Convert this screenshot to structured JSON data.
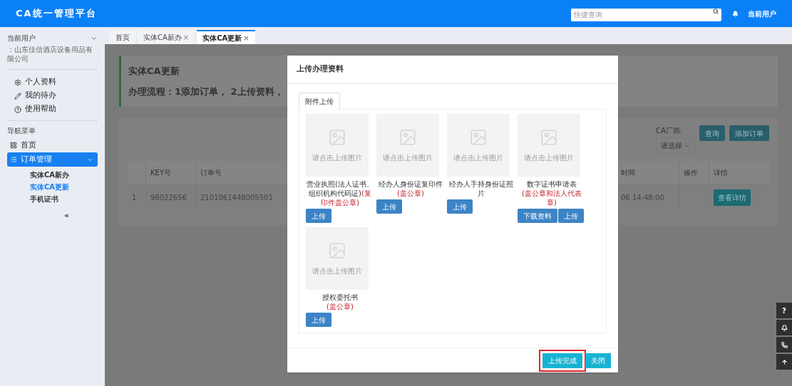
{
  "app_title": "CA统一管理平台",
  "topbar": {
    "search_placeholder": "快捷查询",
    "user": "当前用户"
  },
  "sidebar": {
    "user_label": "当前用户",
    "company": "：山东佳信酒店设备用品有限公司",
    "links": [
      {
        "label": "个人资料",
        "kind": "gear"
      },
      {
        "label": "我的待办",
        "kind": "pencil"
      },
      {
        "label": "使用帮助",
        "kind": "help"
      }
    ],
    "nav_title": "导航菜单",
    "nav": [
      {
        "label": "首页",
        "kind": "grid",
        "selected": false,
        "expanded": false
      },
      {
        "label": "订单管理",
        "kind": "list",
        "selected": true,
        "expanded": true,
        "children": [
          {
            "label": "实体CA新办",
            "selected": false
          },
          {
            "label": "实体CA更新",
            "selected": true
          },
          {
            "label": "手机证书",
            "selected": false
          }
        ]
      }
    ],
    "collapse": "«"
  },
  "tabs": [
    {
      "label": "首页",
      "selected": false
    },
    {
      "label": "实体CA新办",
      "close": "×",
      "selected": false
    },
    {
      "label": "实体CA更新",
      "close": "×",
      "selected": true
    }
  ],
  "page": {
    "title": "实体CA更新",
    "process": "办理流程：1添加订单， 2上传资料，",
    "filter_label": "CA厂商:",
    "select": "请选择",
    "buttons": [
      "查询",
      "添加订单"
    ],
    "table": {
      "columns": [
        "KEY号",
        "订单号",
        "时间",
        "操作",
        "详情"
      ],
      "rows": [
        {
          "index": "1",
          "cells": [
            "98022656",
            "2101061448005501",
            "06 14:48:00"
          ],
          "action": "查看详情"
        }
      ]
    }
  },
  "modal": {
    "title": "上传办理资料",
    "tabs": [
      {
        "label": "附件上传",
        "selected": true
      }
    ],
    "items": [
      {
        "hint": "请点击上传图片",
        "label": "营业执照(法人证书、组织机构代码证)",
        "note": "(复印件盖公章)",
        "note_inline": true,
        "buttons": [
          "上传"
        ]
      },
      {
        "hint": "请点击上传图片",
        "label": "经办人身份证复印件",
        "note": "(盖公章)",
        "note_inline": false,
        "buttons": [
          "上传"
        ]
      },
      {
        "hint": "请点击上传图片",
        "label": "经办人手持身份证照片",
        "buttons": [
          "上传"
        ]
      },
      {
        "hint": "请点击上传图片",
        "label": "数字证书申请表",
        "note": "(盖公章和法人代表章)",
        "note_inline": false,
        "buttons": [
          "下载资料",
          "上传"
        ]
      },
      {
        "hint": "请点击上传图片",
        "label": "授权委托书",
        "note": "(盖公章)",
        "note_inline": false,
        "buttons": [
          "上传"
        ]
      }
    ],
    "footer": [
      {
        "label": "上传完成",
        "highlighted": true
      },
      {
        "label": "关闭",
        "highlighted": false
      }
    ]
  },
  "float_buttons": [
    {
      "kind": "help",
      "label": "?"
    },
    {
      "kind": "bell"
    },
    {
      "kind": "phone"
    },
    {
      "kind": "up"
    }
  ]
}
